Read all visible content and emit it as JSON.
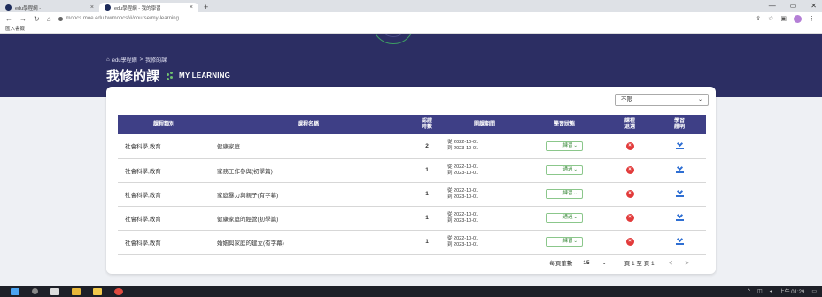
{
  "browser": {
    "tabs": [
      {
        "title": "edu學程網 -"
      },
      {
        "title": "edu學程網 - 我的學習"
      }
    ],
    "new_tab": "+",
    "url": "moocs.moe.edu.tw/moocs/#/course/my-learning",
    "bookmark": "匯入書籤"
  },
  "header": {
    "breadcrumb_home": "edu學程網",
    "breadcrumb_sep": ">",
    "breadcrumb_current": "我修的課",
    "title": "我修的課",
    "title_en": "MY LEARNING"
  },
  "filter": {
    "value": "不限"
  },
  "table": {
    "headers": {
      "category": "課程類別",
      "name": "課程名稱",
      "hours_l1": "認證",
      "hours_l2": "時數",
      "period": "開課期間",
      "status": "學習狀態",
      "drop_l1": "課程",
      "drop_l2": "退選",
      "cert_l1": "學習",
      "cert_l2": "證明"
    },
    "rows": [
      {
        "category": "社會科學,教育",
        "name": "健康家庭",
        "hours": "2",
        "from": "從 2022-10-01",
        "to": "到 2023-10-01",
        "status": "練習"
      },
      {
        "category": "社會科學,教育",
        "name": "家務工作參與(初學篇)",
        "hours": "1",
        "from": "從 2022-10-01",
        "to": "到 2023-10-01",
        "status": "通過"
      },
      {
        "category": "社會科學,教育",
        "name": "家庭暴力與親子(有字幕)",
        "hours": "1",
        "from": "從 2022-10-01",
        "to": "到 2023-10-01",
        "status": "練習"
      },
      {
        "category": "社會科學,教育",
        "name": "健康家庭的經營(初學篇)",
        "hours": "1",
        "from": "從 2022-10-01",
        "to": "到 2023-10-01",
        "status": "通過"
      },
      {
        "category": "社會科學,教育",
        "name": "婚姻與家庭的建立(有字幕)",
        "hours": "1",
        "from": "從 2022-10-01",
        "to": "到 2023-10-01",
        "status": "練習"
      }
    ]
  },
  "pager": {
    "per_page_label": "每頁筆數",
    "per_page": "15",
    "page_info": "頁 1 至 頁 1",
    "prev": "<",
    "next": ">"
  },
  "taskbar": {
    "clock": "上午 01:29"
  },
  "colors": {
    "banner": "#2c2e63",
    "header": "#3e3f86",
    "accent": "#3d9d63"
  }
}
